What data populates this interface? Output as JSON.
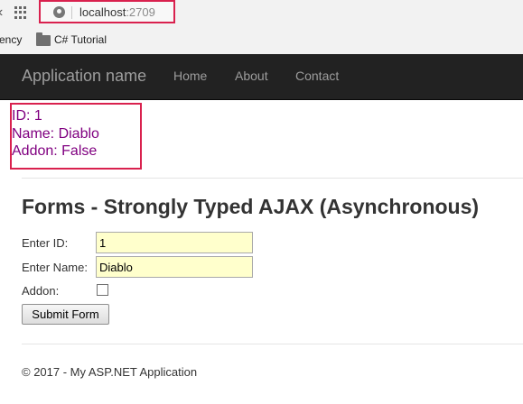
{
  "browser": {
    "address_host": "localhost",
    "address_port": ":2709",
    "bookmark_partial": "ency",
    "bookmark_label": "C# Tutorial",
    "accent_color": "#d9214e"
  },
  "navbar": {
    "brand": "Application name",
    "links": [
      {
        "label": "Home"
      },
      {
        "label": "About"
      },
      {
        "label": "Contact"
      }
    ],
    "background": "#222222"
  },
  "result": {
    "id_line": "ID: 1",
    "name_line": "Name: Diablo",
    "addon_line": "Addon: False",
    "color": "#800080"
  },
  "form": {
    "title": "Forms - Strongly Typed AJAX (Asynchronous)",
    "id_label": "Enter ID:",
    "id_value": "1",
    "name_label": "Enter Name:",
    "name_value": "Diablo",
    "addon_label": "Addon:",
    "addon_checked": false,
    "submit_label": "Submit Form"
  },
  "footer": {
    "text": "© 2017 - My ASP.NET Application"
  },
  "icons": {
    "back": "chevron-left-icon",
    "apps": "apps-grid-icon",
    "site": "globe-icon",
    "bookmark": "folder-icon"
  }
}
